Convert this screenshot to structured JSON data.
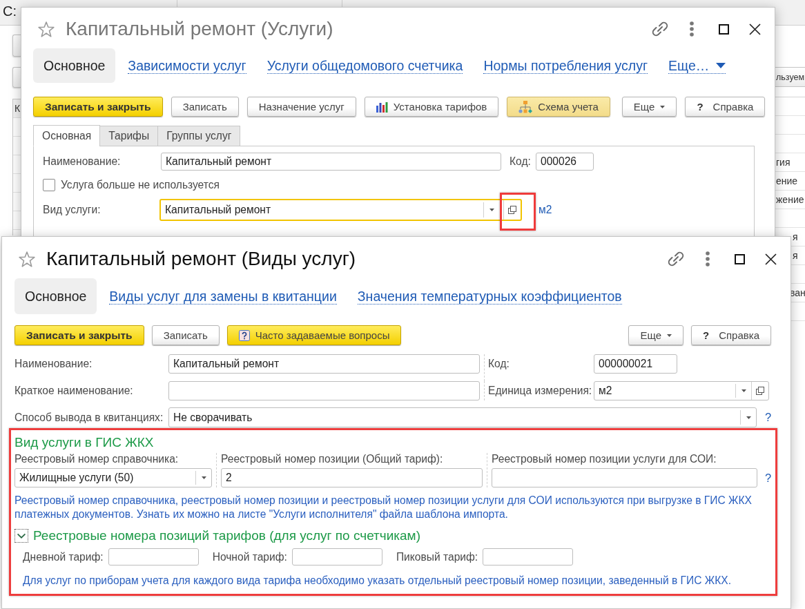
{
  "background_app": {
    "tabs": [
      {
        "label": "С:"
      }
    ],
    "table_header": "К",
    "side_button": "льзуем",
    "side_cells": [
      "гия",
      "ение",
      "жение",
      "я",
      "я",
      "ван"
    ]
  },
  "service_window": {
    "title": "Капитальный ремонт (Услуги)",
    "active": false,
    "nav": [
      {
        "label": "Основное",
        "selected": true
      },
      {
        "label": "Зависимости услуг",
        "selected": false
      },
      {
        "label": "Услуги общедомового счетчика",
        "selected": false
      },
      {
        "label": "Нормы потребления услуг",
        "selected": false
      }
    ],
    "nav_more": "Еще…",
    "toolbar": [
      {
        "label": "Записать и закрыть",
        "kind": "primary"
      },
      {
        "label": "Записать",
        "kind": "default"
      },
      {
        "label": "Назначение услуг",
        "kind": "default"
      },
      {
        "label": "Установка тарифов",
        "kind": "default"
      },
      {
        "label": "Схема учета",
        "kind": "pressed"
      },
      {
        "label": "Еще",
        "kind": "menu"
      },
      {
        "label": "Справка",
        "kind": "default",
        "glyph": "?"
      }
    ],
    "tabs": [
      {
        "label": "Основная",
        "selected": true
      },
      {
        "label": "Тарифы",
        "selected": false
      },
      {
        "label": "Группы услуг",
        "selected": false
      }
    ],
    "name": {
      "label": "Наименование:",
      "value": "Капитальный ремонт"
    },
    "code": {
      "label": "Код:",
      "value": "000026"
    },
    "not_used": {
      "label": "Услуга больше не используется",
      "checked": false
    },
    "service_kind": {
      "label": "Вид услуги:",
      "value": "Капитальный ремонт",
      "focused": true,
      "link": "м2"
    }
  },
  "service_kind_window": {
    "title": "Капитальный ремонт (Виды услуг)",
    "active": true,
    "nav": [
      {
        "label": "Основное",
        "selected": true
      },
      {
        "label": "Виды услуг для замены в квитанции",
        "selected": false
      },
      {
        "label": "Значения температурных коэффициентов",
        "selected": false
      }
    ],
    "toolbar": [
      {
        "label": "Записать и закрыть",
        "kind": "primary"
      },
      {
        "label": "Записать",
        "kind": "default"
      },
      {
        "label": "Часто задаваемые вопросы",
        "kind": "accent"
      }
    ],
    "toolbar_right": [
      {
        "label": "Еще",
        "kind": "menu"
      },
      {
        "label": "Справка",
        "kind": "default",
        "glyph": "?"
      }
    ],
    "name": {
      "label": "Наименование:",
      "value": "Капитальный ремонт"
    },
    "code": {
      "label": "Код:",
      "value": "000000021"
    },
    "short_name": {
      "label": "Краткое наименование:"
    },
    "unit": {
      "label": "Единица измерения:",
      "value": "м2"
    },
    "output_mode": {
      "label": "Способ вывода в квитанциях:",
      "value": "Не сворачивать",
      "help": "?"
    },
    "gis": {
      "title": "Вид услуги в ГИС ЖКХ",
      "registry": {
        "label": "Реестровый номер справочника:",
        "value": "Жилищные услуги (50)"
      },
      "position": {
        "label": "Реестровый номер позиции (Общий тариф):",
        "value": "2"
      },
      "soi_position": {
        "label": "Реестровый номер позиции услуги для СОИ:"
      },
      "help": "?",
      "note": "Реестровый номер справочника, реестровый номер позиции и реестровый номер позиции услуги для СОИ используются при выгрузке в ГИС ЖКХ платежных документов. Узнать их можно на листе \"Услуги исполнителя\" файла шаблона импорта.",
      "tariffs": {
        "title": "Реестровые номера позиций тарифов (для услуг по счетчикам)",
        "expanded": true,
        "fields": [
          {
            "label": "Дневной тариф:"
          },
          {
            "label": "Ночной тариф:"
          },
          {
            "label": "Пиковый тариф:"
          }
        ],
        "note": "Для услуг по приборам учета для каждого вида тарифа необходимо указать отдельный реестровый номер позиции, заведенный в ГИС ЖКХ."
      }
    }
  }
}
